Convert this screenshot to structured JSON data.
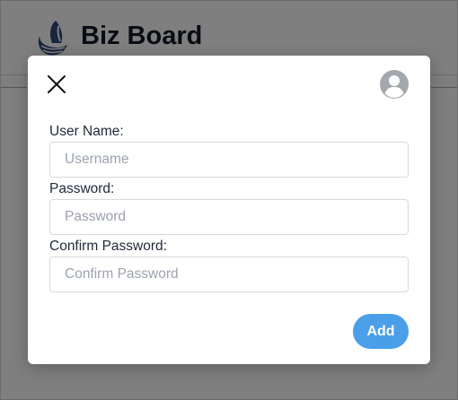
{
  "header": {
    "title": "Biz Board",
    "logo_icon": "sailboat-wave-logo"
  },
  "modal": {
    "close_icon": "close-icon",
    "avatar_icon": "user-avatar-icon",
    "fields": [
      {
        "label": "User Name:",
        "placeholder": "Username",
        "value": ""
      },
      {
        "label": "Password:",
        "placeholder": "Password",
        "value": ""
      },
      {
        "label": "Confirm Password:",
        "placeholder": "Confirm Password",
        "value": ""
      }
    ],
    "add_label": "Add"
  },
  "colors": {
    "accent": "#4a9fe8",
    "title": "#111827",
    "logo": "#2f4a7a",
    "overlay": "rgba(0,0,0,0.5)"
  }
}
